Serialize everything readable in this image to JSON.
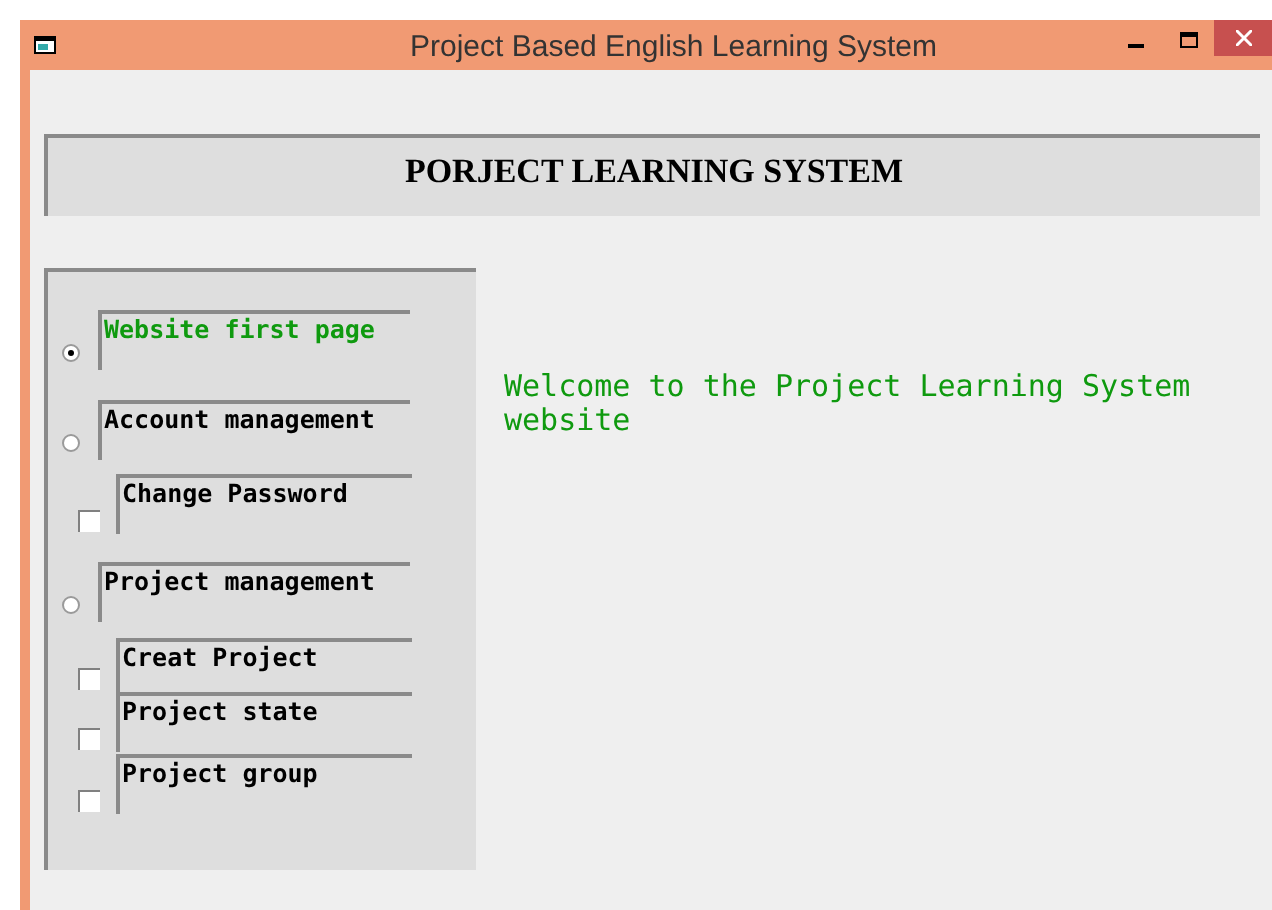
{
  "window": {
    "title": "Project Based English Learning System"
  },
  "header": {
    "title": "PORJECT LEARNING SYSTEM"
  },
  "menu": [
    {
      "kind": "radio",
      "label": "Website first page",
      "selected": true
    },
    {
      "kind": "radio",
      "label": "Account management",
      "selected": false
    },
    {
      "kind": "checkbox",
      "label": "Change Password",
      "checked": false
    },
    {
      "kind": "radio",
      "label": "Project management",
      "selected": false
    },
    {
      "kind": "checkbox",
      "label": "Creat Project",
      "checked": false
    },
    {
      "kind": "checkbox",
      "label": "Project state",
      "checked": false
    },
    {
      "kind": "checkbox",
      "label": "Project group",
      "checked": false
    }
  ],
  "welcome": "Welcome to the Project Learning System website"
}
